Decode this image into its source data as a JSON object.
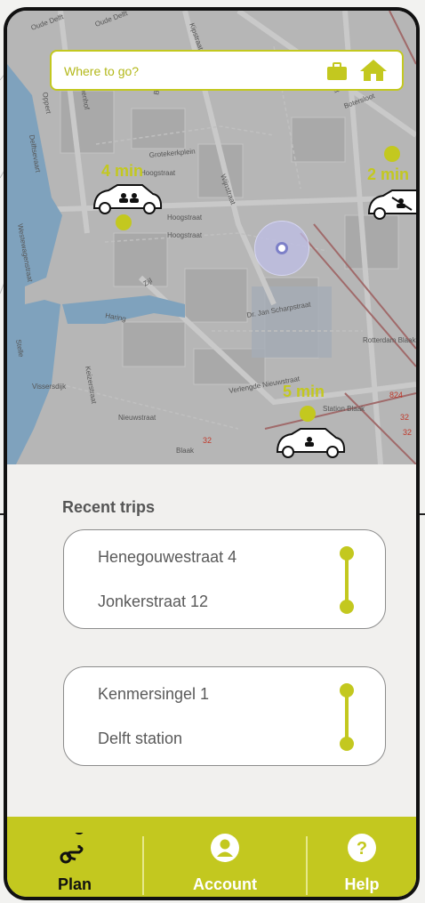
{
  "search": {
    "placeholder": "Where to go?"
  },
  "map": {
    "etas": [
      {
        "label": "4 min"
      },
      {
        "label": "2 min"
      },
      {
        "label": "5 min"
      }
    ],
    "street_labels": [
      "Oude Delft",
      "Oude Delft",
      "Delftsevaart",
      "Bagijnenhof",
      "Oppert",
      "Binnenrotte",
      "Botersloot",
      "Kipstraat",
      "Prinsenhof",
      "Grotekerkplein",
      "Hoogstraat",
      "Zijl",
      "Haring",
      "Vissersdijk",
      "Keizerstraat",
      "Nieuwstraat",
      "Dr. Jan Scharpstraat",
      "Verlengde Nieuwstraat",
      "Blaak",
      "Station Blaak",
      "Rotterdam Blaak",
      "Wijnstraat",
      "Stelle",
      "Westewagenstraat",
      "Hoogstraat",
      "Botersloot",
      "Hoogstraat"
    ],
    "route_numbers": [
      "32",
      "32",
      "824",
      "32"
    ],
    "accent": "#c3c81f"
  },
  "recent": {
    "title": "Recent trips",
    "trips": [
      {
        "from": "Henegouwestraat 4",
        "to": "Jonkerstraat 12"
      },
      {
        "from": "Kenmersingel 1",
        "to": "Delft station"
      }
    ]
  },
  "nav": {
    "items": [
      {
        "label": "Plan",
        "icon": "route-icon",
        "active": true
      },
      {
        "label": "Account",
        "icon": "user-circle-icon",
        "active": false
      },
      {
        "label": "Help",
        "icon": "question-circle-icon",
        "active": false
      }
    ]
  }
}
